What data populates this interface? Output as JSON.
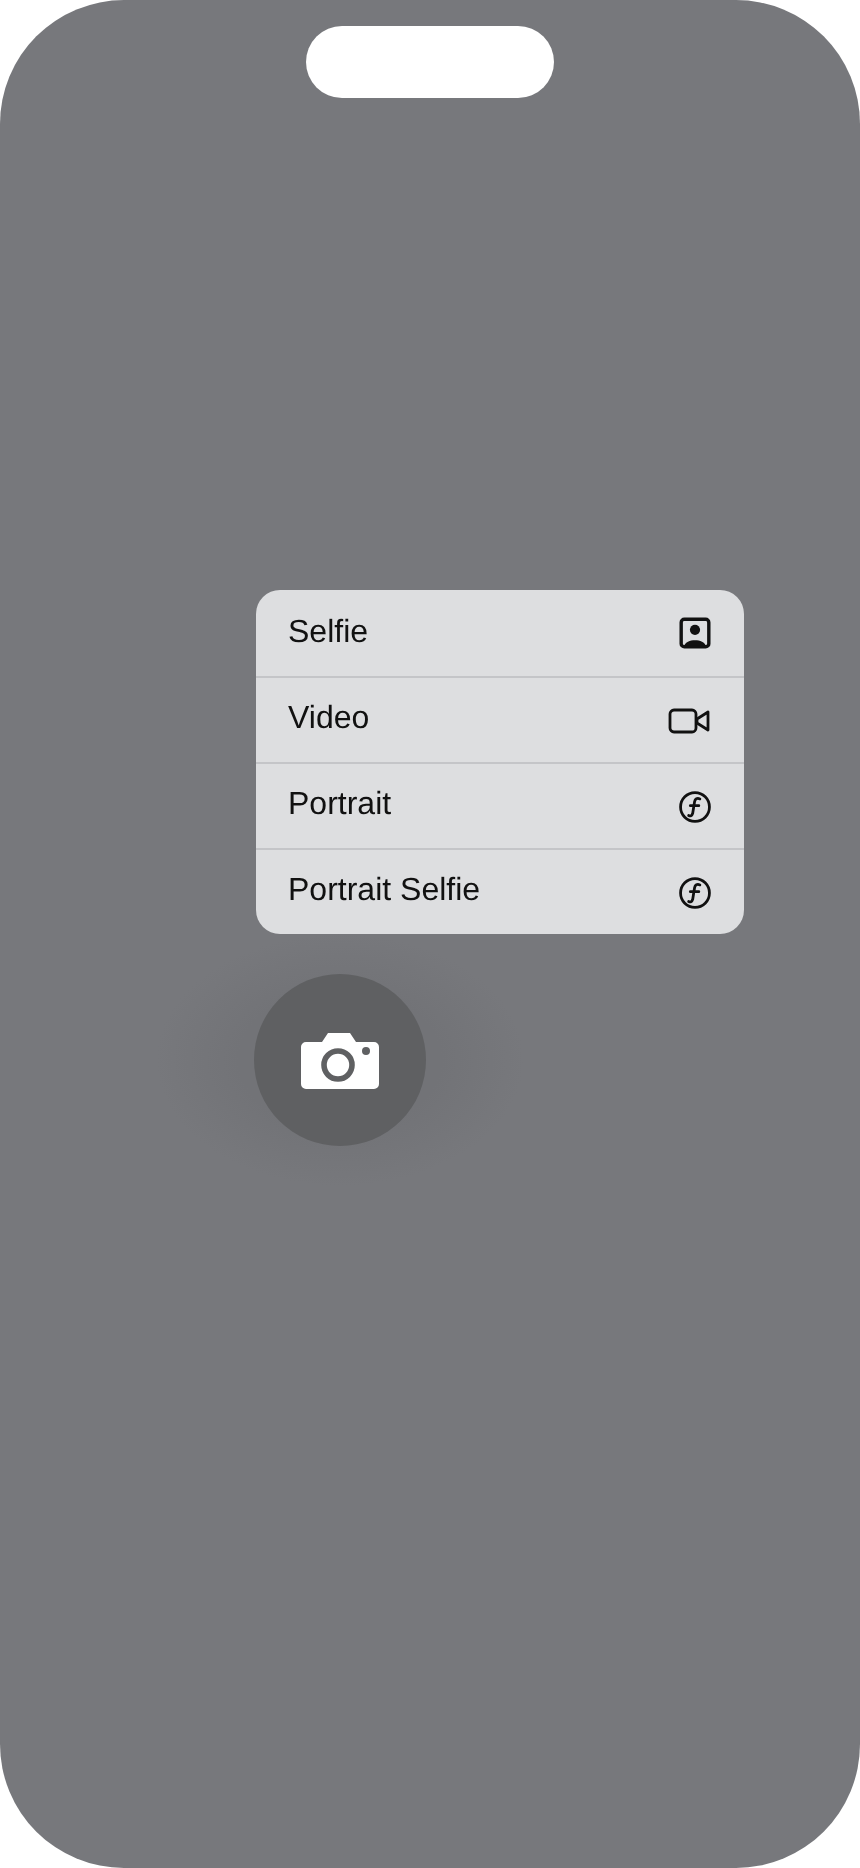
{
  "menu": {
    "items": [
      {
        "label": "Selfie",
        "kind": "selfie"
      },
      {
        "label": "Video",
        "kind": "video"
      },
      {
        "label": "Portrait",
        "kind": "portrait"
      },
      {
        "label": "Portrait Selfie",
        "kind": "portrait"
      }
    ]
  },
  "camera_button": {
    "kind": "camera"
  }
}
